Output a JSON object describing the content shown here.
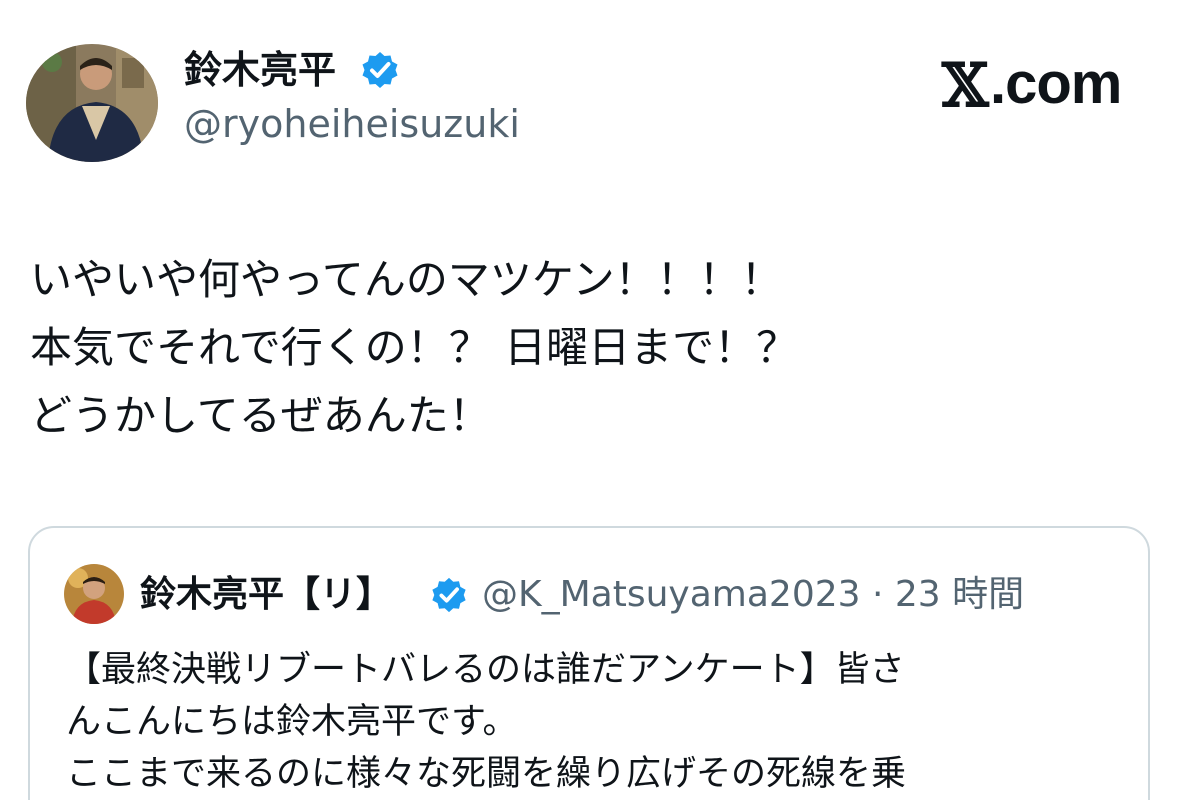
{
  "author": {
    "name": "鈴木亮平",
    "handle": "@ryoheiheisuzuki",
    "verified": true,
    "badge_color": "#1d9bf0"
  },
  "brand": {
    "logo": "𝕏",
    "site": ".com"
  },
  "tweet": {
    "lines": [
      "いやいや何やってんのマツケン！！！！",
      "本気でそれで行くの！？ 日曜日まで！？",
      "どうかしてるぜあんた！"
    ]
  },
  "quote": {
    "name": "鈴木亮平【リ】",
    "verified": true,
    "meta": "@K_Matsuyama2023 · 23 時間",
    "lines": [
      "【最終決戦リブートバレるのは誰だアンケート】皆さ",
      "んこんにちは鈴木亮平です。",
      "ここまで来るのに様々な死闘を繰り広げその死線を乗"
    ]
  },
  "colors": {
    "text": "#0f1419",
    "secondary": "#536471",
    "border": "#cfd9de"
  }
}
